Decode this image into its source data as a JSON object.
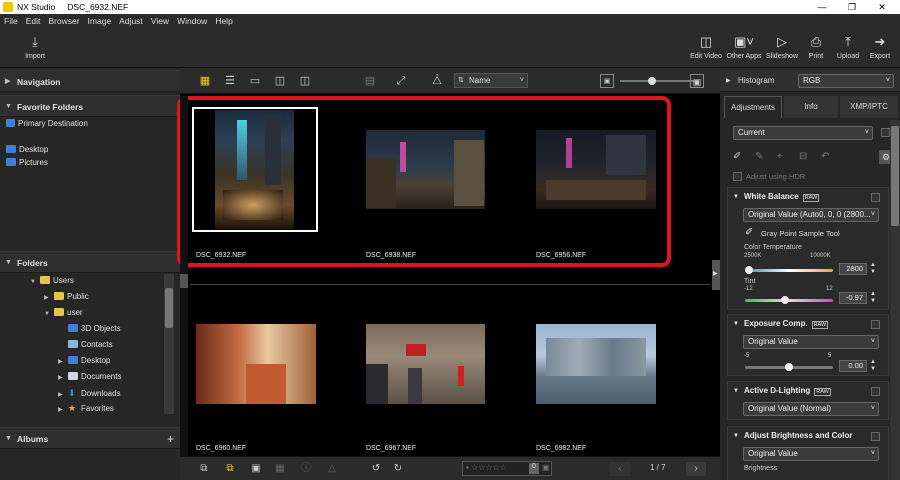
{
  "window": {
    "app_title": "NX Studio",
    "file_name": "DSC_6932.NEF"
  },
  "menu": [
    "File",
    "Edit",
    "Browser",
    "Image",
    "Adjust",
    "View",
    "Window",
    "Help"
  ],
  "toolbar": {
    "import_label": "Import",
    "edit_video_label": "Edit Video",
    "other_apps_label": "Other Apps",
    "slideshow_label": "Slideshow",
    "print_label": "Print",
    "upload_label": "Upload",
    "export_label": "Export"
  },
  "left_panel": {
    "navigation": "Navigation",
    "favorite_folders": "Favorite Folders",
    "primary_destination": "Primary Destination",
    "favorites": [
      "Desktop",
      "Pictures"
    ],
    "folders": "Folders",
    "tree": [
      {
        "label": "Users",
        "icon": "folder"
      },
      {
        "label": "Public",
        "icon": "folder"
      },
      {
        "label": "user",
        "icon": "folder"
      },
      {
        "label": "3D Objects",
        "icon": "3d-folder"
      },
      {
        "label": "Contacts",
        "icon": "contacts-folder"
      },
      {
        "label": "Desktop",
        "icon": "desktop-folder"
      },
      {
        "label": "Documents",
        "icon": "documents-folder"
      },
      {
        "label": "Downloads",
        "icon": "download-folder"
      },
      {
        "label": "Favorites",
        "icon": "star-folder"
      }
    ],
    "albums": "Albums",
    "albums_add": "+"
  },
  "browser": {
    "sort_label": "Name",
    "thumbnails": [
      {
        "name": "DSC_6932.NEF",
        "selected": true
      },
      {
        "name": "DSC_6938.NEF",
        "selected": false
      },
      {
        "name": "DSC_6956.NEF",
        "selected": false
      },
      {
        "name": "DSC_6960.NEF",
        "selected": false
      },
      {
        "name": "DSC_6967.NEF",
        "selected": false
      },
      {
        "name": "DSC_6982.NEF",
        "selected": false
      }
    ],
    "page_indicator": "1 / 7",
    "rating_box": "0",
    "highlight_color": "#e0151b"
  },
  "right_panel": {
    "histogram_label": "Histogram",
    "histogram_channel": "RGB",
    "tabs": [
      "Adjustments",
      "Info",
      "XMP/IPTC"
    ],
    "preset_value": "Current",
    "adjust_hdr": "Adjust using HDR",
    "white_balance": {
      "title": "White Balance",
      "value": "Original Value (Auto0, 0, 0 (2800...",
      "gray_point": "Gray Point Sample Tool",
      "color_temp_label": "Color Temperature",
      "temp_min": "2500K",
      "temp_max": "10000K",
      "temp_value": "2800",
      "temp_level": 0.04,
      "tint_label": "Tint",
      "tint_min": "-12",
      "tint_max": "12",
      "tint_value": "-0.97",
      "tint_level": 0.46
    },
    "exposure": {
      "title": "Exposure Comp.",
      "value": "Original Value",
      "min": "-5",
      "max": "5",
      "number": "0.00",
      "level": 0.5
    },
    "adl": {
      "title": "Active D-Lighting",
      "value": "Original Value (Normal)"
    },
    "brightness": {
      "title": "Adjust Brightness and Color",
      "value": "Original Value",
      "brightness_label": "Brightness"
    },
    "raw_badge": "RAW"
  }
}
